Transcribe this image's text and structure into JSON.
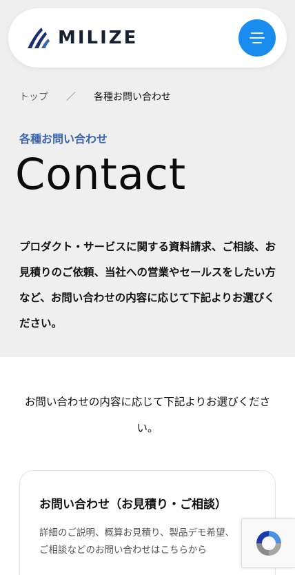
{
  "header": {
    "logo_text": "MILIZE",
    "menu_icon": "menu-lines-icon",
    "colors": {
      "menu_bg": "#1a8cf0",
      "logo_mark": "#1f2f6e"
    }
  },
  "breadcrumb": {
    "home": "トップ",
    "separator": "／",
    "current": "各種お問い合わせ"
  },
  "hero": {
    "eyebrow": "各種お問い合わせ",
    "title": "Contact",
    "intro": "プロダクト・サービスに関する資料請求、ご相談、お見積りのご依頼、当社への営業やセールスをしたい方など、お問い合わせの内容に応じて下記よりお選びください。"
  },
  "main": {
    "lead": "お問い合わせの内容に応じて下記よりお選びください。",
    "cards": [
      {
        "title": "お問い合わせ（お見積り・ご相談）",
        "description": "詳細のご説明、概算お見積り、製品デモ希望、ご相談などのお問い合わせはこちらから"
      }
    ]
  },
  "recaptcha": {
    "icon": "recaptcha-icon"
  }
}
